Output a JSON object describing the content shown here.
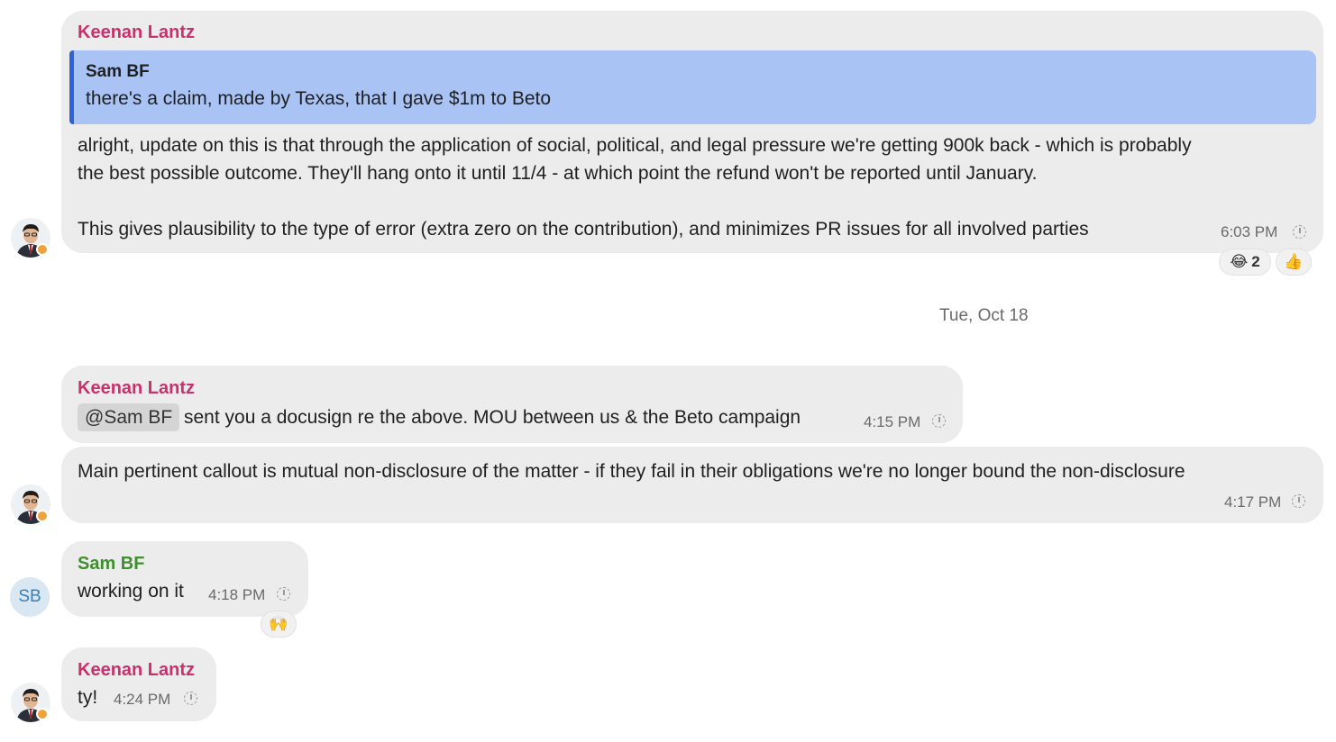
{
  "messages": {
    "m1": {
      "sender": "Keenan Lantz",
      "quote_author": "Sam BF",
      "quote_text": "there's a claim, made by Texas, that I gave $1m to Beto",
      "line1": "alright, update on this is that through the application of social, political, and legal pressure we're getting 900k back - which is probably",
      "line2": "the best possible outcome. They'll hang onto it until 11/4 - at which point the refund won't be reported until January.",
      "line3": "This gives plausibility to the type of error (extra zero on the contribution), and minimizes PR issues for all involved parties",
      "time": "6:03 PM",
      "reactions": [
        {
          "emoji": "😂",
          "count": "2"
        },
        {
          "emoji": "👍",
          "count": ""
        }
      ]
    },
    "date_separator": "Tue, Oct 18",
    "m2": {
      "sender": "Keenan Lantz",
      "mention": "@Sam BF",
      "text": "sent you a docusign re the above. MOU between us & the Beto campaign",
      "time": "4:15 PM"
    },
    "m3": {
      "text": "Main pertinent callout is mutual non-disclosure of the matter - if they fail in their obligations we're no longer bound the non-disclosure",
      "time": "4:17 PM"
    },
    "m4": {
      "sender": "Sam BF",
      "avatar_initials": "SB",
      "text": "working on it",
      "time": "4:18 PM",
      "reaction": "🙌"
    },
    "m5": {
      "sender": "Keenan Lantz",
      "text": "ty!",
      "time": "4:24 PM"
    }
  },
  "icons": {
    "pending": "clock-icon",
    "avatar_badge": "status-badge"
  },
  "colors": {
    "keenan_name": "#c9306c",
    "sam_name": "#3f8f2e",
    "quote_bg": "#a9c3f5",
    "quote_bar": "#2e62d9",
    "bubble_bg": "#ececec"
  }
}
